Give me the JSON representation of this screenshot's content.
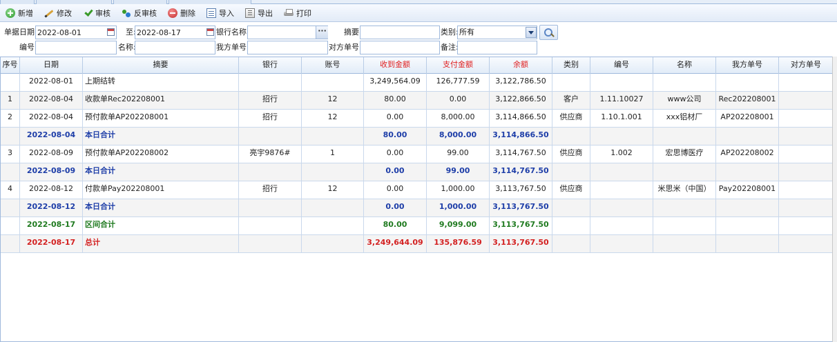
{
  "toolbar": {
    "buttons": [
      {
        "label": "新增",
        "icon": "add-icon"
      },
      {
        "label": "修改",
        "icon": "edit-icon"
      },
      {
        "label": "审核",
        "icon": "check-icon"
      },
      {
        "label": "反审核",
        "icon": "uncheck-icon"
      },
      {
        "label": "删除",
        "icon": "delete-icon"
      },
      {
        "label": "导入",
        "icon": "import-icon"
      },
      {
        "label": "导出",
        "icon": "export-icon"
      },
      {
        "label": "打印",
        "icon": "print-icon"
      }
    ]
  },
  "filters": {
    "date_label": "单据日期:",
    "date_from": "2022-08-01",
    "to_label": "至:",
    "date_to": "2022-08-17",
    "bank_label": "银行名称:",
    "bank_value": "",
    "summary_label": "摘要:",
    "summary_value": "",
    "category_label": "类别:",
    "category_value": "所有",
    "code_label": "编号:",
    "code_value": "",
    "name_label": "名称:",
    "name_value": "",
    "our_no_label": "我方单号:",
    "our_no_value": "",
    "their_no_label": "对方单号:",
    "their_no_value": "",
    "remark_label": "备注:",
    "remark_value": ""
  },
  "grid": {
    "columns": [
      "序号",
      "日期",
      "摘要",
      "银行",
      "账号",
      "收到金额",
      "支付金额",
      "余额",
      "类别",
      "编号",
      "名称",
      "我方单号",
      "对方单号"
    ],
    "rows": [
      {
        "type": "normal",
        "cells": [
          "",
          "2022-08-01",
          "上期结转",
          "",
          "",
          "3,249,564.09",
          "126,777.59",
          "3,122,786.50",
          "",
          "",
          "",
          "",
          ""
        ]
      },
      {
        "type": "normal",
        "cells": [
          "1",
          "2022-08-04",
          "收款单Rec202208001",
          "招行",
          "12",
          "80.00",
          "0.00",
          "3,122,866.50",
          "客户",
          "1.11.10027",
          "www公司",
          "Rec202208001",
          ""
        ]
      },
      {
        "type": "normal",
        "cells": [
          "2",
          "2022-08-04",
          "预付款单AP202208001",
          "招行",
          "12",
          "0.00",
          "8,000.00",
          "3,114,866.50",
          "供应商",
          "1.10.1.001",
          "xxx铝材厂",
          "AP202208001",
          ""
        ]
      },
      {
        "type": "blue",
        "cells": [
          "",
          "2022-08-04",
          "本日合计",
          "",
          "",
          "80.00",
          "8,000.00",
          "3,114,866.50",
          "",
          "",
          "",
          "",
          ""
        ]
      },
      {
        "type": "normal",
        "cells": [
          "3",
          "2022-08-09",
          "预付款单AP202208002",
          "亮宇9876#",
          "1",
          "0.00",
          "99.00",
          "3,114,767.50",
          "供应商",
          "1.002",
          "宏思博医疗",
          "AP202208002",
          ""
        ]
      },
      {
        "type": "blue",
        "cells": [
          "",
          "2022-08-09",
          "本日合计",
          "",
          "",
          "0.00",
          "99.00",
          "3,114,767.50",
          "",
          "",
          "",
          "",
          ""
        ]
      },
      {
        "type": "normal",
        "cells": [
          "4",
          "2022-08-12",
          "付款单Pay202208001",
          "招行",
          "12",
          "0.00",
          "1,000.00",
          "3,113,767.50",
          "供应商",
          "",
          "米思米（中国）",
          "Pay202208001",
          ""
        ]
      },
      {
        "type": "blue",
        "cells": [
          "",
          "2022-08-12",
          "本日合计",
          "",
          "",
          "0.00",
          "1,000.00",
          "3,113,767.50",
          "",
          "",
          "",
          "",
          ""
        ]
      },
      {
        "type": "green",
        "cells": [
          "",
          "2022-08-17",
          "区间合计",
          "",
          "",
          "80.00",
          "9,099.00",
          "3,113,767.50",
          "",
          "",
          "",
          "",
          ""
        ]
      },
      {
        "type": "red",
        "cells": [
          "",
          "2022-08-17",
          "总计",
          "",
          "",
          "3,249,644.09",
          "135,876.59",
          "3,113,767.50",
          "",
          "",
          "",
          "",
          ""
        ]
      }
    ]
  },
  "colors": {
    "header_red": "#e02020",
    "subtotal_blue": "#1e3ea8",
    "range_total_green": "#1f7a1f",
    "grand_total_red": "#d32020"
  }
}
